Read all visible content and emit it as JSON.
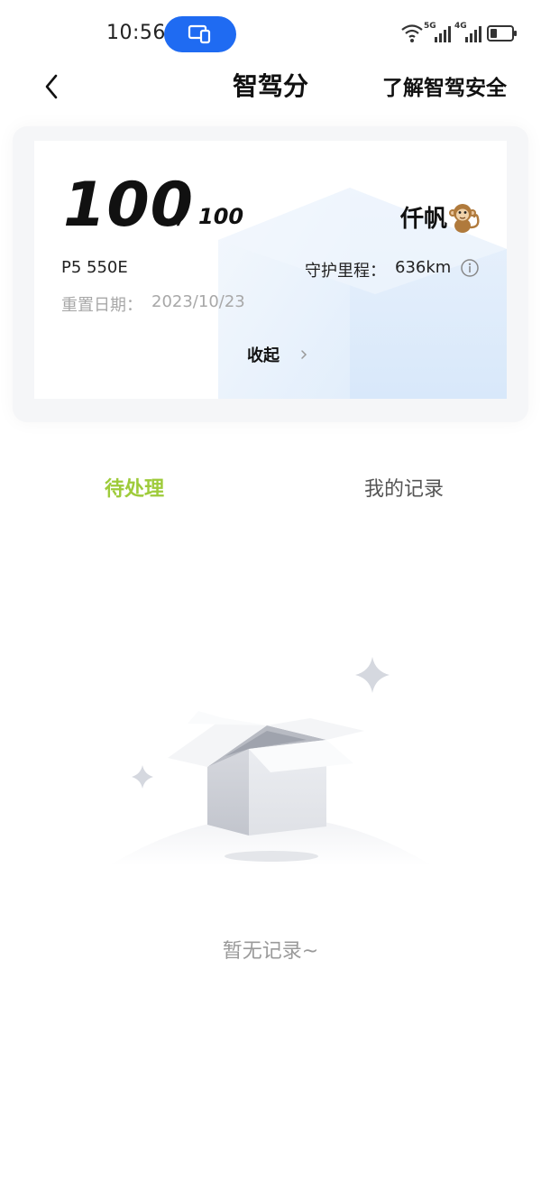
{
  "status_bar": {
    "time": "10:56",
    "network_1": "5G",
    "network_2": "4G",
    "icons": [
      "screen-share-icon",
      "wifi-icon",
      "signal-icon",
      "battery-icon"
    ]
  },
  "header": {
    "title": "智驾分",
    "link": "了解智驾安全"
  },
  "score_card": {
    "score": "100",
    "separator": "/",
    "max_score": "100",
    "user_name": "仟帆",
    "vehicle_model": "P5 550E",
    "mileage_label": "守护里程：",
    "mileage_value": "636km",
    "reset_label": "重置日期：",
    "reset_date": "2023/10/23",
    "collapse_label": "收起"
  },
  "tabs": [
    {
      "label": "待处理",
      "active": true
    },
    {
      "label": "我的记录",
      "active": false
    }
  ],
  "empty_state": {
    "message": "暂无记录~"
  },
  "colors": {
    "accent": "#9ecb3a",
    "status_pill": "#1f6bf2",
    "card_tint": "#e6f0fc"
  }
}
